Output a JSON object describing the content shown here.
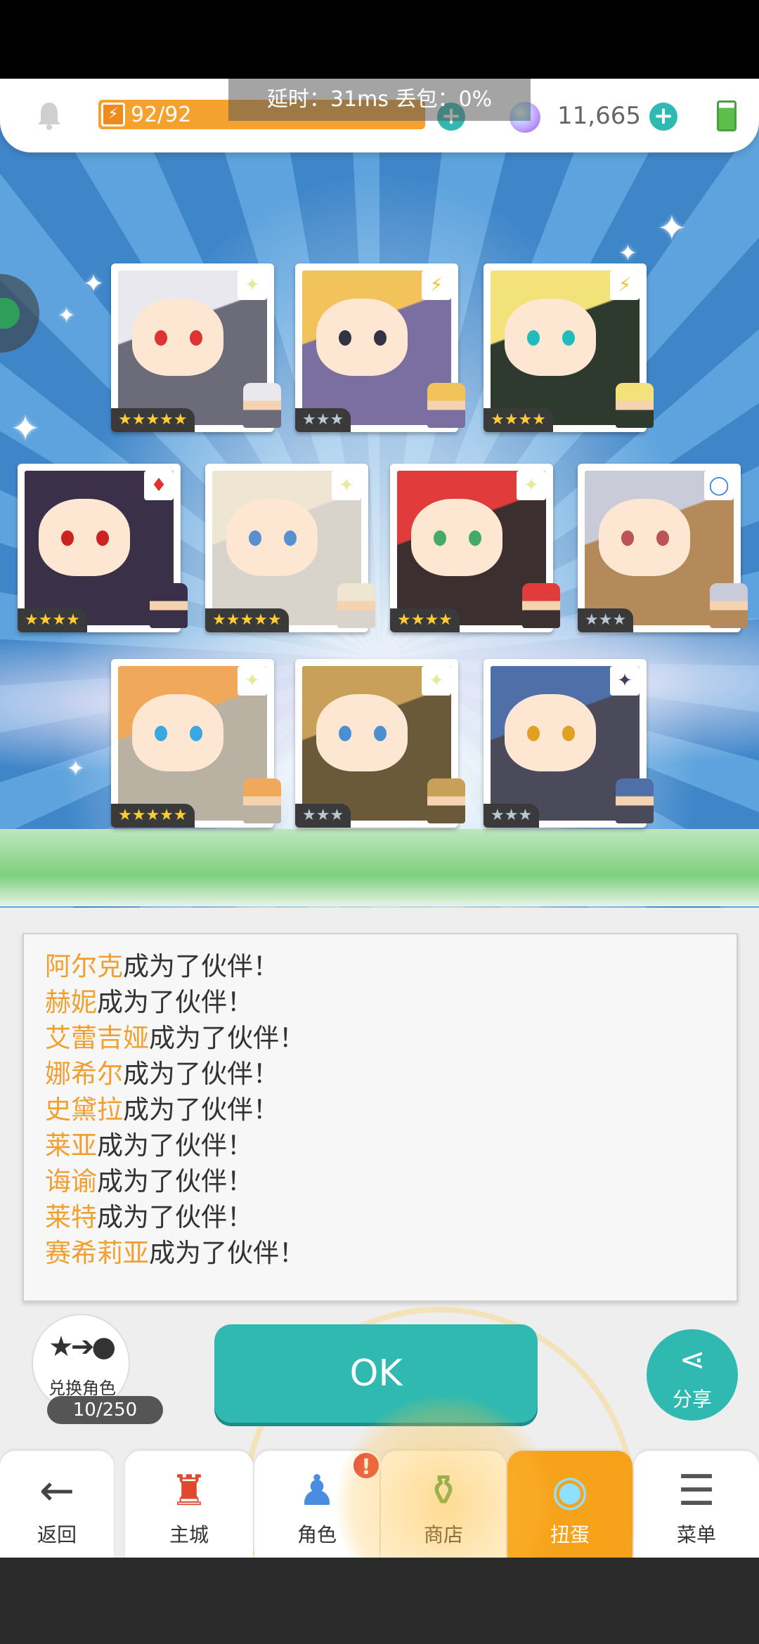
{
  "status": {
    "stamina_text": "92/92",
    "stamina_fraction": 1.0,
    "network_text": "延时：31ms 丢包：0%",
    "gems": "11,665"
  },
  "colors": {
    "accent": "#2fb9b1",
    "highlight": "#f0a030",
    "active_tab": "#f7a21b"
  },
  "cards": [
    {
      "stars": "★★★★★",
      "element": "light",
      "rarity": 5
    },
    {
      "stars": "★★★",
      "element": "lightning",
      "rarity": 3
    },
    {
      "stars": "★★★★",
      "element": "lightning",
      "rarity": 4
    },
    {
      "stars": "★★★★",
      "element": "fire",
      "rarity": 4
    },
    {
      "stars": "★★★★★",
      "element": "light",
      "rarity": 5
    },
    {
      "stars": "★★★★",
      "element": "light",
      "rarity": 4
    },
    {
      "stars": "★★★",
      "element": "water",
      "rarity": 3
    },
    {
      "stars": "★★★★★",
      "element": "light",
      "rarity": 5
    },
    {
      "stars": "★★★",
      "element": "light",
      "rarity": 3
    },
    {
      "stars": "★★★",
      "element": "dark",
      "rarity": 3
    }
  ],
  "log": [
    {
      "name": "阿尔克",
      "msg": "成为了伙伴！"
    },
    {
      "name": "赫妮",
      "msg": "成为了伙伴！"
    },
    {
      "name": "艾蕾吉娅",
      "msg": "成为了伙伴！"
    },
    {
      "name": "娜希尔",
      "msg": "成为了伙伴！"
    },
    {
      "name": "史黛拉",
      "msg": "成为了伙伴！"
    },
    {
      "name": "莱亚",
      "msg": "成为了伙伴！"
    },
    {
      "name": "诲谕",
      "msg": "成为了伙伴！"
    },
    {
      "name": "莱特",
      "msg": "成为了伙伴！"
    },
    {
      "name": "赛希莉亚",
      "msg": "成为了伙伴！"
    }
  ],
  "exchange": {
    "label": "兑换角色",
    "count": "10/250"
  },
  "ok_label": "OK",
  "share_label": "分享",
  "nav": {
    "back": "返回",
    "town": "主城",
    "hero": "角色",
    "shop": "商店",
    "gacha": "扭蛋",
    "menu": "菜单",
    "badge": "!"
  }
}
